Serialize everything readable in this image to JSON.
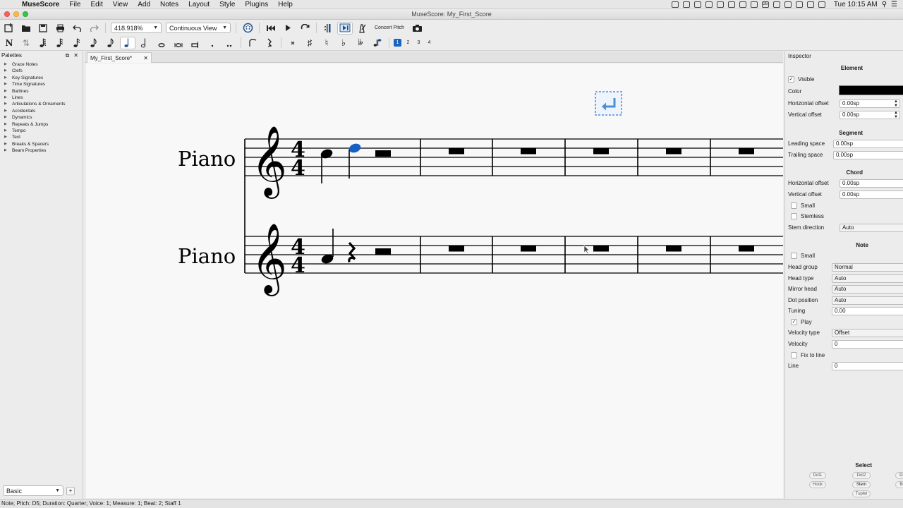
{
  "menubar": {
    "items": [
      "MuseScore",
      "File",
      "Edit",
      "View",
      "Add",
      "Notes",
      "Layout",
      "Style",
      "Plugins",
      "Help"
    ],
    "clock": "Tue 10:15 AM",
    "tray_badge": "26"
  },
  "window": {
    "title": "MuseScore: My_First_Score"
  },
  "toolbar": {
    "zoom": "418.918%",
    "view_mode": "Continuous View",
    "concert_pitch": "Concert Pitch",
    "voices": [
      "1",
      "2",
      "3",
      "4"
    ],
    "active_voice": "1"
  },
  "palettes": {
    "title": "Palettes",
    "items": [
      "Grace Notes",
      "Clefs",
      "Key Signatures",
      "Time Signatures",
      "Barlines",
      "Lines",
      "Articulations & Ornaments",
      "Accidentals",
      "Dynamics",
      "Repeats & Jumps",
      "Tempo",
      "Text",
      "Breaks & Spacers",
      "Beam Properties"
    ],
    "workspace": "Basic"
  },
  "score": {
    "tab_label": "My_First_Score*",
    "staves": [
      {
        "name": "Piano",
        "time_top": "4",
        "time_bottom": "4"
      },
      {
        "name": "Piano",
        "time_top": "4",
        "time_bottom": "4"
      }
    ],
    "measure_count": 6,
    "colors": {
      "selected": "#1460c4",
      "ink": "#000000",
      "paper": "#f8f8f8",
      "breaker": "#4a90d9"
    }
  },
  "inspector": {
    "title": "Inspector",
    "element": {
      "heading": "Element",
      "visible_label": "Visible",
      "visible": true,
      "color_label": "Color",
      "color": "#000000",
      "hoffset_label": "Horizontal offset",
      "hoffset": "0.00sp",
      "voffset_label": "Vertical offset",
      "voffset": "0.00sp"
    },
    "segment": {
      "heading": "Segment",
      "leading_label": "Leading space",
      "leading": "0.00sp",
      "trailing_label": "Trailing space",
      "trailing": "0.00sp"
    },
    "chord": {
      "heading": "Chord",
      "hoffset_label": "Horizontal offset",
      "hoffset": "0.00sp",
      "voffset_label": "Vertical offset",
      "voffset": "0.00sp",
      "small_label": "Small",
      "stemless_label": "Stemless",
      "stemdir_label": "Stem direction",
      "stemdir": "Auto"
    },
    "note": {
      "heading": "Note",
      "small_label": "Small",
      "headgroup_label": "Head group",
      "headgroup": "Normal",
      "headtype_label": "Head type",
      "headtype": "Auto",
      "mirror_label": "Mirror head",
      "mirror": "Auto",
      "dotpos_label": "Dot position",
      "dotpos": "Auto",
      "tuning_label": "Tuning",
      "tuning": "0.00",
      "play_label": "Play",
      "play": true,
      "veltype_label": "Velocity type",
      "veltype": "Offset",
      "velocity_label": "Velocity",
      "velocity": "0",
      "fixline_label": "Fix to line",
      "line_label": "Line",
      "line": "0"
    },
    "select": {
      "heading": "Select",
      "buttons": [
        "Dot1",
        "Dot2",
        "Hook",
        "Stem",
        "Tuplet"
      ]
    }
  },
  "statusbar": {
    "text": "Note; Pitch: D5; Duration: Quarter; Voice: 1;  Measure: 1; Beat: 2; Staff 1"
  }
}
